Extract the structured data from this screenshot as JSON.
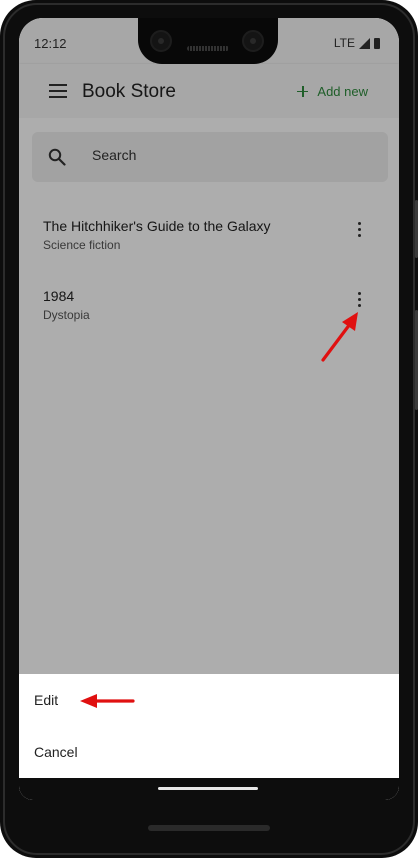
{
  "status_bar": {
    "time": "12:12",
    "network": "LTE"
  },
  "app_bar": {
    "title": "Book Store",
    "add_new_label": "Add new"
  },
  "search": {
    "placeholder": "Search"
  },
  "books": [
    {
      "title": "The Hitchhiker's Guide to the Galaxy",
      "genre": "Science fiction"
    },
    {
      "title": "1984",
      "genre": "Dystopia"
    }
  ],
  "bottom_sheet": {
    "items": [
      {
        "label": "Edit"
      },
      {
        "label": "Cancel"
      }
    ]
  },
  "colors": {
    "accent": "#2e8b3d",
    "annotation_arrow": "#e01010"
  },
  "icons": [
    "menu-icon",
    "plus-icon",
    "search-icon",
    "more-vert-icon",
    "signal-icon",
    "battery-icon"
  ]
}
